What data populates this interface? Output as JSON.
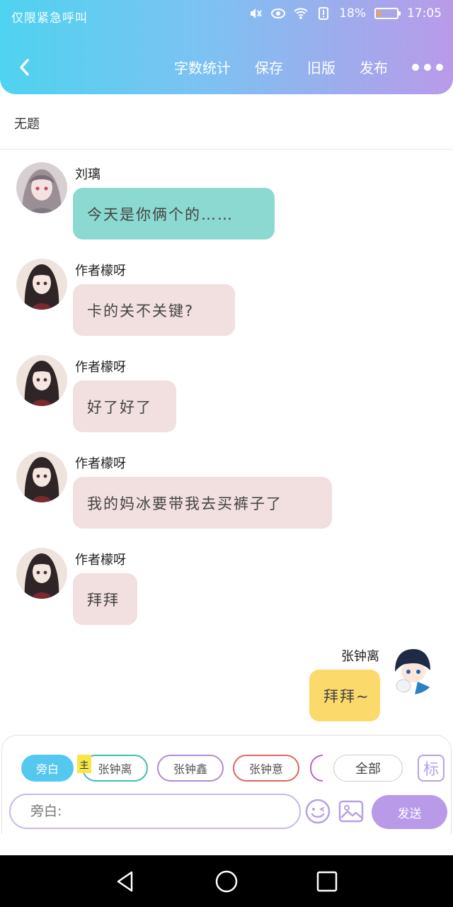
{
  "status_bar": {
    "left_text": "仅限紧急呼叫",
    "battery_percent": "18%",
    "battery_level": 0.18,
    "time": "17:05"
  },
  "header": {
    "actions": [
      "字数统计",
      "保存",
      "旧版",
      "发布"
    ],
    "accent_gradient": [
      "#4fd3f0",
      "#b99ae9"
    ]
  },
  "title": "无题",
  "messages": [
    {
      "sender": "刘璃",
      "text": "今天是你俩个的……",
      "side": "left",
      "color": "#8bd9d0"
    },
    {
      "sender": "作者檬呀",
      "text": "卡的关不关键?",
      "side": "left",
      "color": "#f2dfdf"
    },
    {
      "sender": "作者檬呀",
      "text": "好了好了",
      "side": "left",
      "color": "#f2dfdf"
    },
    {
      "sender": "作者檬呀",
      "text": "我的妈冰要带我去买裤子了",
      "side": "left",
      "color": "#f2dfdf"
    },
    {
      "sender": "作者檬呀",
      "text": "拜拜",
      "side": "left",
      "color": "#f2dfdf"
    },
    {
      "sender": "张钟离",
      "text": "拜拜~",
      "side": "right",
      "color": "#fbd96a"
    }
  ],
  "role_chips": [
    {
      "label": "旁白",
      "selected": true,
      "color": "#55c8f0"
    },
    {
      "label": "张钟离",
      "selected": false,
      "color": "#3cbfb0",
      "badge": "主"
    },
    {
      "label": "张钟鑫",
      "selected": false,
      "color": "#b08ad8"
    },
    {
      "label": "张钟意",
      "selected": false,
      "color": "#e0645a"
    },
    {
      "label": "全部",
      "selected": false,
      "color": "#cccccc"
    }
  ],
  "mark_button": "标",
  "input": {
    "placeholder": "旁白:"
  },
  "send_label": "发送"
}
